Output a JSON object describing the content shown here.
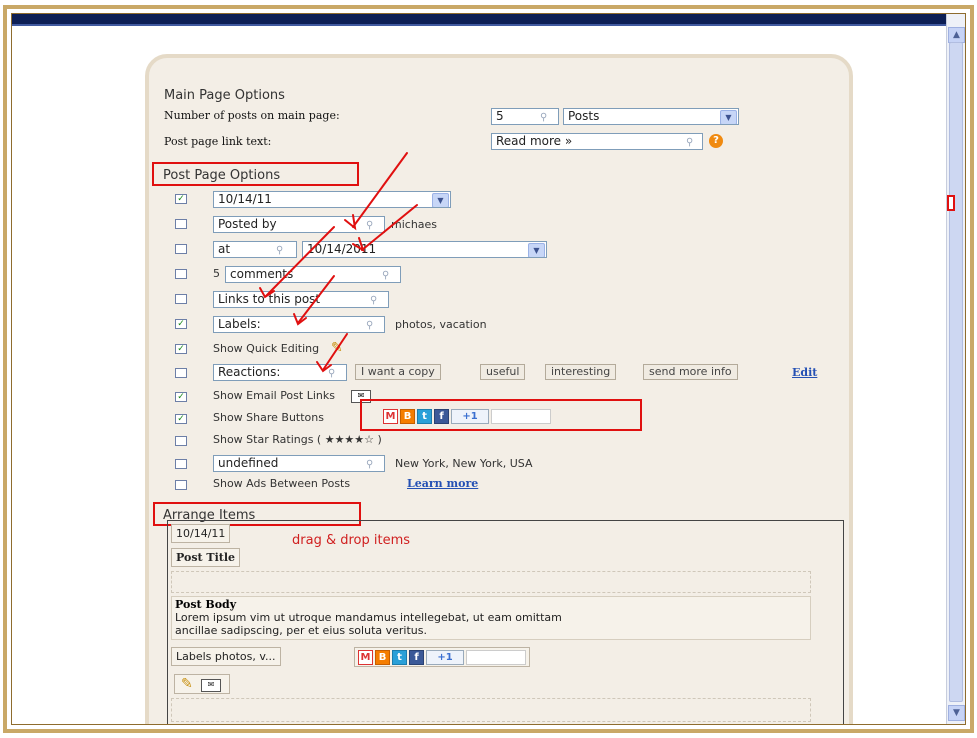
{
  "main": {
    "title": "Main Page Options",
    "num_posts_label": "Number of posts on main page:",
    "num_posts_value": "5",
    "posts_unit": "Posts",
    "link_text_label": "Post page link text:",
    "link_text_value": "Read more »",
    "help_icon": "?"
  },
  "post_page": {
    "title": "Post Page Options",
    "date_value": "10/14/11",
    "posted_by_value": "Posted by",
    "author": "michaes",
    "at_value": "at",
    "time_value": "10/14/2011",
    "comments_count": "5",
    "comments_value": "comments",
    "links_value": "Links to this post",
    "labels_value": "Labels:",
    "labels_list": "photos, vacation",
    "quick_edit_label": "Show Quick Editing",
    "reactions_value": "Reactions:",
    "reaction_buttons": [
      "I want a copy",
      "useful",
      "interesting",
      "send more info"
    ],
    "edit_link": "Edit",
    "email_label": "Show Email Post Links",
    "share_label": "Show Share Buttons",
    "plus_one": "+1",
    "star_label": "Show Star Ratings ( ★★★★☆ )",
    "location_value": "undefined",
    "location_text": "New York, New York, USA",
    "ads_label": "Show Ads Between Posts",
    "learn_more": "Learn more"
  },
  "arrange": {
    "title": "Arrange Items",
    "date_item": "10/14/11",
    "drag_hint": "drag & drop items",
    "post_title": "Post Title",
    "post_body_title": "Post Body",
    "post_body_text_1": "Lorem ipsum vim ut utroque mandamus intellegebat, ut eam omittam",
    "post_body_text_2": "ancillae sadipscing, per et eius soluta veritus.",
    "labels_item": "Labels photos, v...",
    "plus_one": "+1"
  },
  "colors": {
    "annotation_red": "#e01010",
    "panel_bg": "#f3eee6",
    "frame_gold": "#c9a867",
    "link_blue": "#2450b4"
  },
  "icons": [
    "mic-icon",
    "dropdown-icon",
    "help-icon",
    "pencil-icon",
    "email-icon",
    "gmail-icon",
    "blogger-icon",
    "twitter-icon",
    "facebook-icon",
    "plusone-icon"
  ],
  "checkboxes": {
    "date": true,
    "posted_by": false,
    "at": false,
    "comments": false,
    "links": false,
    "labels": true,
    "quick_edit": true,
    "reactions": false,
    "email": true,
    "share": true,
    "star": false,
    "location": false,
    "ads": false
  }
}
